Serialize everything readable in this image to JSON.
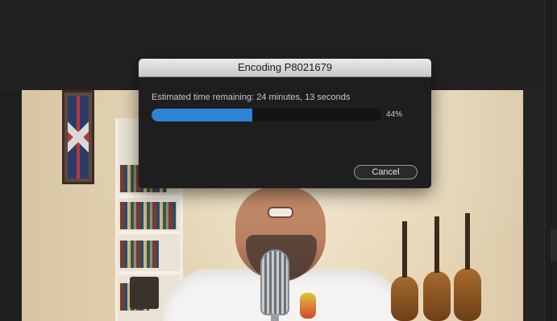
{
  "dialog": {
    "title": "Encoding P8021679",
    "status_text": "Estimated time remaining: 24 minutes, 13 seconds",
    "progress_label": "44%",
    "progress_fraction": 0.44,
    "cancel_label": "Cancel"
  },
  "colors": {
    "progress_fill": "#2d84d6",
    "dialog_background": "#1e1e1e",
    "app_background": "#232323"
  }
}
